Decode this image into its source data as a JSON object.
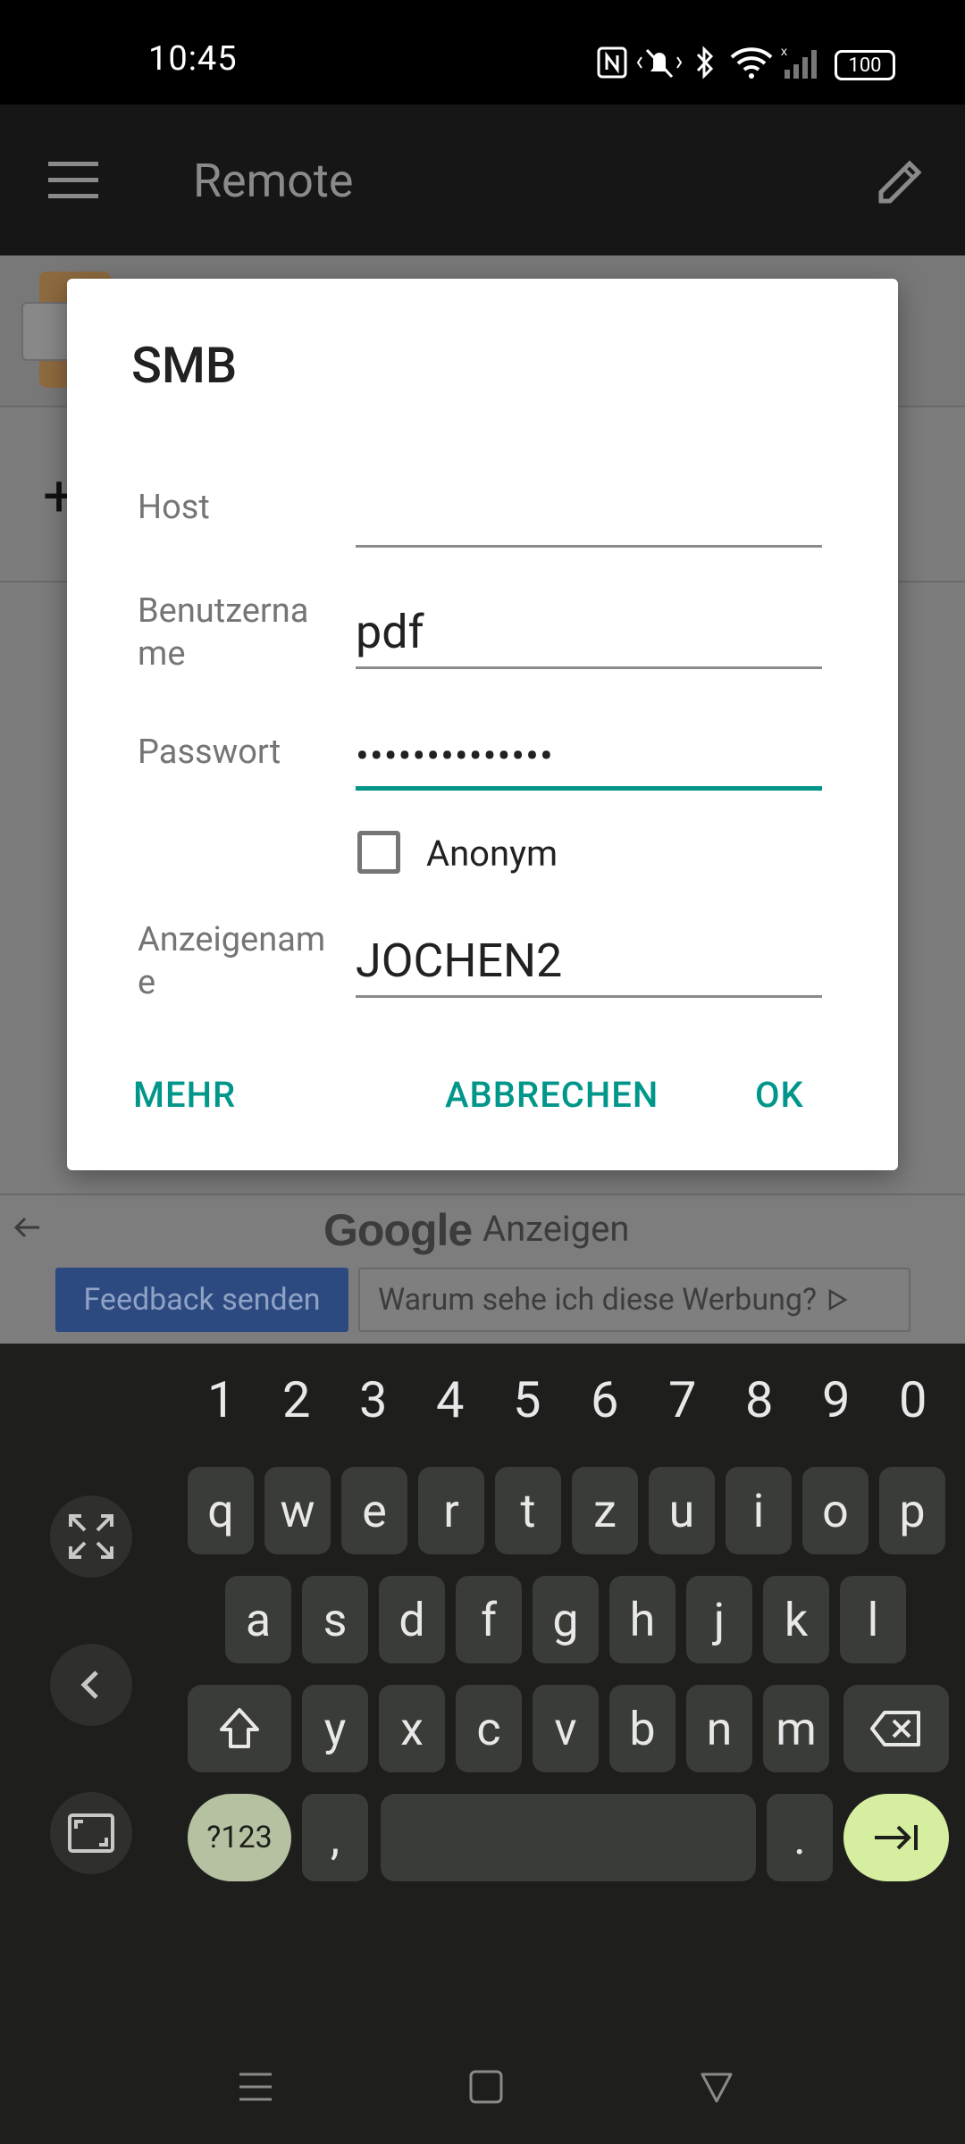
{
  "status": {
    "time": "10:45",
    "battery": "100"
  },
  "appbar": {
    "title": "Remote"
  },
  "dialog": {
    "title": "SMB",
    "host_label": "Host",
    "host_value": "",
    "user_label_1": "Benutzerna",
    "user_label_2": "me",
    "user_value": "pdf",
    "pass_label": "Passwort",
    "pass_value": "••••••••••••••",
    "anon_label": "Anonym",
    "display_label_1": "Anzeigenam",
    "display_label_2": "e",
    "display_value": "JOCHEN2",
    "more_button": "MEHR",
    "cancel_button": "ABBRECHEN",
    "ok_button": "OK"
  },
  "ad": {
    "brand": "Google",
    "label": "Anzeigen",
    "feedback": "Feedback senden",
    "why": "Warum sehe ich diese Werbung?"
  },
  "keyboard": {
    "numbers": [
      "1",
      "2",
      "3",
      "4",
      "5",
      "6",
      "7",
      "8",
      "9",
      "0"
    ],
    "row1": [
      "q",
      "w",
      "e",
      "r",
      "t",
      "z",
      "u",
      "i",
      "o",
      "p"
    ],
    "row2": [
      "a",
      "s",
      "d",
      "f",
      "g",
      "h",
      "j",
      "k",
      "l"
    ],
    "row3": [
      "y",
      "x",
      "c",
      "v",
      "b",
      "n",
      "m"
    ],
    "sym_label": "?123",
    "comma": ",",
    "period": "."
  },
  "colors": {
    "accent": "#00968a",
    "dialog_bg": "#ffffff",
    "keyboard_bg": "#1e1f1c",
    "enter_key": "#d5eea0",
    "sym_key": "#b5c1a0"
  }
}
